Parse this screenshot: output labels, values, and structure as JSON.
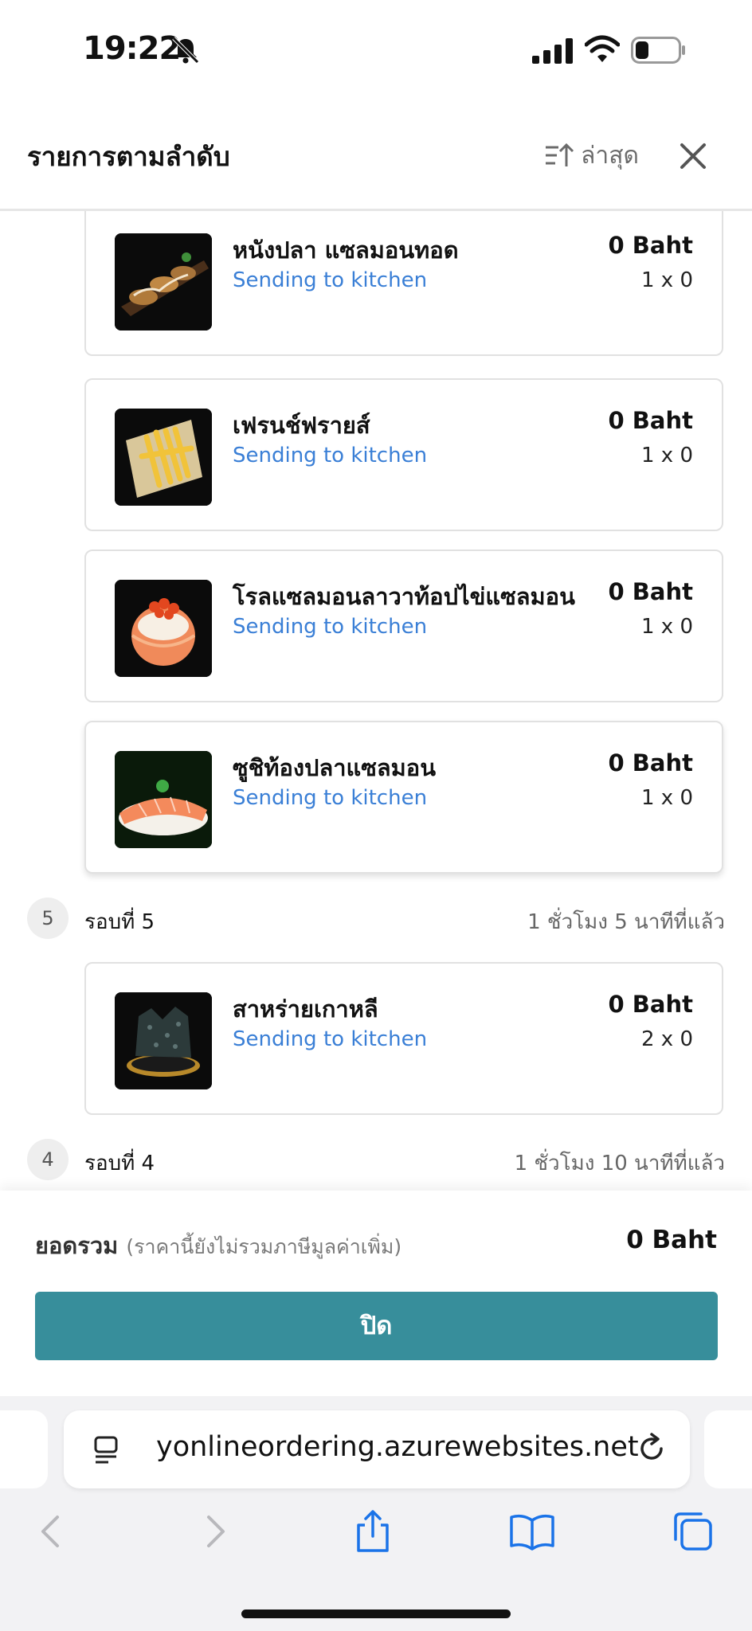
{
  "status": {
    "time": "19:22"
  },
  "header": {
    "title": "รายการตามลำดับ",
    "sort_label": "ล่าสุด"
  },
  "items": [
    {
      "name": "หนังปลา แซลมอนทอด",
      "status": "Sending to kitchen",
      "price": "0 Baht",
      "qty": "1 x 0"
    },
    {
      "name": "เฟรนช์ฟรายส์",
      "status": "Sending to kitchen",
      "price": "0 Baht",
      "qty": "1 x 0"
    },
    {
      "name": "โรลแซลมอนลาวาท้อปไข่แซลมอน",
      "status": "Sending to kitchen",
      "price": "0 Baht",
      "qty": "1 x 0"
    },
    {
      "name": "ซูชิท้องปลาแซลมอน",
      "status": "Sending to kitchen",
      "price": "0 Baht",
      "qty": "1 x 0"
    },
    {
      "name": "สาหร่ายเกาหลี",
      "status": "Sending to kitchen",
      "price": "0 Baht",
      "qty": "2 x 0"
    }
  ],
  "rounds": [
    {
      "number": "5",
      "label": "รอบที่ 5",
      "time": "1 ชั่วโมง 5 นาทีที่แล้ว"
    },
    {
      "number": "4",
      "label": "รอบที่ 4",
      "time": "1 ชั่วโมง 10 นาทีที่แล้ว"
    }
  ],
  "summary": {
    "total_label": "ยอดรวม",
    "total_note": "(ราคานี้ยังไม่รวมภาษีมูลค่าเพิ่ม)",
    "total_value": "0 Baht",
    "close_label": "ปิด"
  },
  "browser": {
    "url": "yonlineordering.azurewebsites.net"
  },
  "colors": {
    "accent": "#378e9b",
    "status_text": "#3a7fd6",
    "safari_blue": "#1a73e8"
  }
}
